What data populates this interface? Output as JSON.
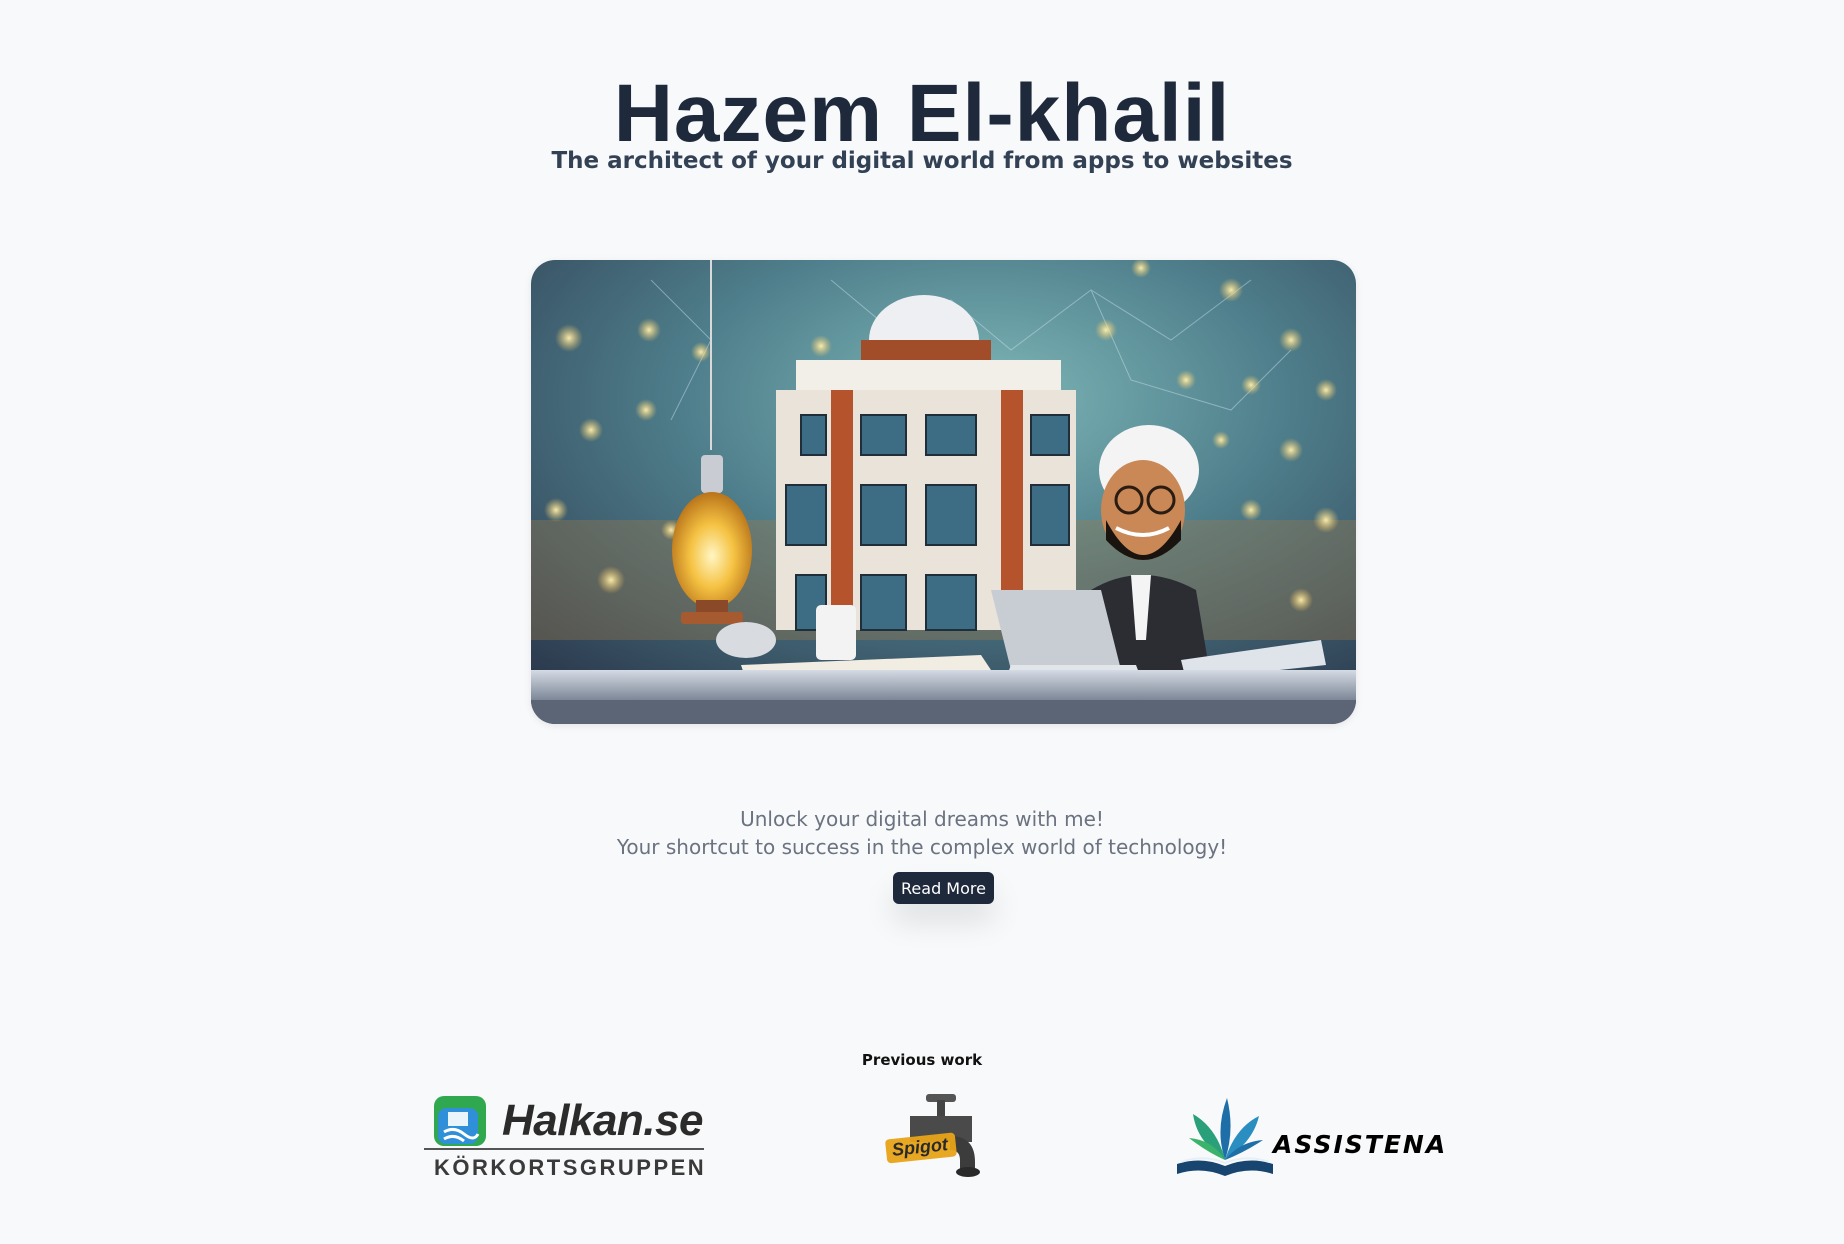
{
  "header": {
    "title": "Hazem El-khalil",
    "subtitle": "The architect of your digital world from apps to websites"
  },
  "hero": {
    "image_icon": "architect-illustration"
  },
  "intro": {
    "line1": "Unlock your digital dreams with me!",
    "line2": "Your shortcut to success in the complex world of technology!",
    "button_label": "Read More"
  },
  "previous_work": {
    "label": "Previous work",
    "logos": [
      {
        "name": "Halkan.se",
        "tagline": "KÖRKORTSGRUPPEN",
        "icon": "halkan-logo-icon"
      },
      {
        "name": "Spigot",
        "icon": "spigot-faucet-icon"
      },
      {
        "name": "ASSISTENA",
        "icon": "book-plant-icon"
      }
    ]
  },
  "colors": {
    "background": "#f8f9fb",
    "title": "#1e293b",
    "button": "#1e293b",
    "muted_text": "#6b7280"
  }
}
